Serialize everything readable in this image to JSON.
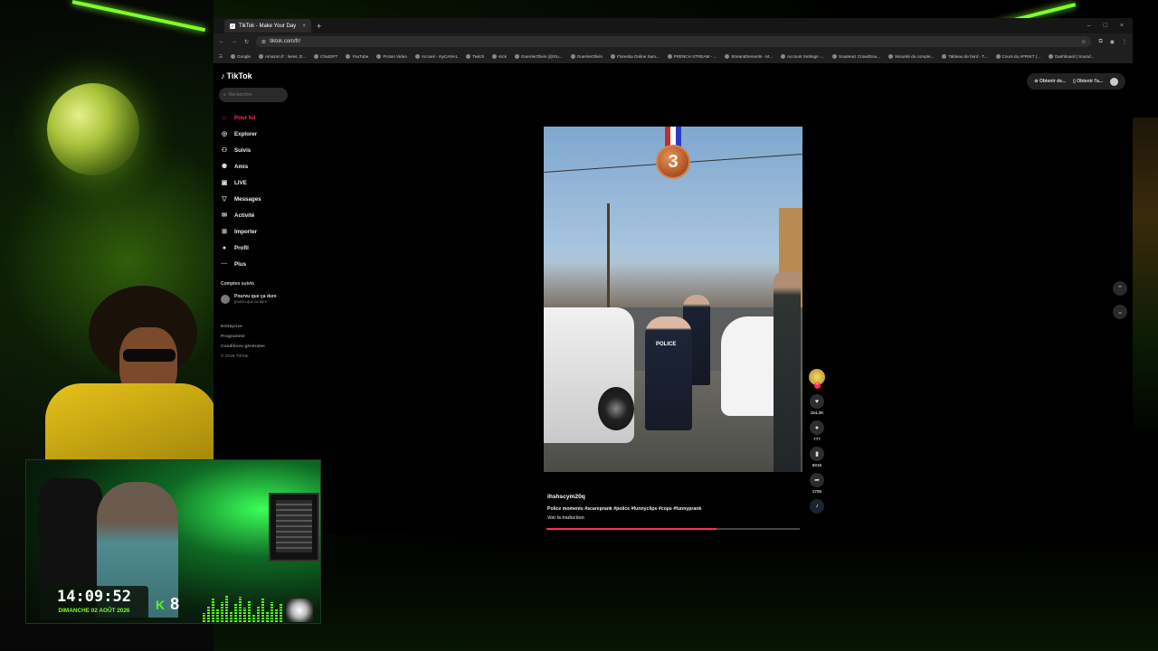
{
  "browser": {
    "tab_title": "TikTok - Make Your Day",
    "tab_close": "×",
    "new_tab": "+",
    "url": "tiktok.com/fr/",
    "window_controls": [
      "–",
      "□",
      "×"
    ],
    "bookmarks": [
      "Google",
      "Amazon.fr : livres, D...",
      "ChatGPT",
      "YouTube",
      "Proton Video",
      "Accueil - myCANAL",
      "Twitch",
      "Kick",
      "GuerrierOlivin (@Gu...",
      "GuerrierOlivin",
      "Florestia Online Sam...",
      "FRENCH STREAM - ...",
      "StreamElements - M...",
      "Account Settings -...",
      "Soutenez CrowdSou...",
      "Sécurité du compte...",
      "Tableau de bord - T...",
      "Cours du AFRIKT (...",
      "Dashboard | Sound..."
    ]
  },
  "tiktok": {
    "logo": "TikTok",
    "search_placeholder": "Rechercher",
    "nav": [
      {
        "label": "Pour toi",
        "icon": "home-icon",
        "glyph": "⌂",
        "active": true
      },
      {
        "label": "Explorer",
        "icon": "compass-icon",
        "glyph": "◎"
      },
      {
        "label": "Suivis",
        "icon": "following-icon",
        "glyph": "⚇"
      },
      {
        "label": "Amis",
        "icon": "friends-icon",
        "glyph": "⚉"
      },
      {
        "label": "LIVE",
        "icon": "live-icon",
        "glyph": "▣"
      },
      {
        "label": "Messages",
        "icon": "messages-icon",
        "glyph": "▽"
      },
      {
        "label": "Activité",
        "icon": "activity-icon",
        "glyph": "✉"
      },
      {
        "label": "Importer",
        "icon": "upload-icon",
        "glyph": "⊞"
      },
      {
        "label": "Profil",
        "icon": "profile-icon",
        "glyph": "●"
      },
      {
        "label": "Plus",
        "icon": "more-icon",
        "glyph": "···"
      }
    ],
    "followed_title": "Comptes suivis",
    "followed": {
      "name": "Pourvu que ça dure",
      "handle": "pourvu.que.ca.dure"
    },
    "footer": [
      "Entreprise",
      "Programme",
      "Conditions générales"
    ],
    "copyright": "© 2026 TikTok",
    "top_right": {
      "btn1": "Obtenir de...",
      "btn2": "Obtenir l'a..."
    },
    "video": {
      "medal_number": "3",
      "officer_text": "POLICE",
      "username": "ihshscym20q",
      "description": "Police moments #scareprank #police #funnyclips #cops #funnyprank",
      "translate": "Voir la traduction",
      "progress": 0.67,
      "likes": "154.3K",
      "comments": "777",
      "saves": "6016",
      "shares": "2755"
    }
  },
  "overlay": {
    "clock_time": "14:09:52",
    "clock_date": "DIMANCHE 02 AOÛT 2026",
    "kick_logo": "K",
    "kick_count": "8"
  },
  "colors": {
    "accent": "#fe2c55",
    "kick_green": "#53fc18"
  }
}
